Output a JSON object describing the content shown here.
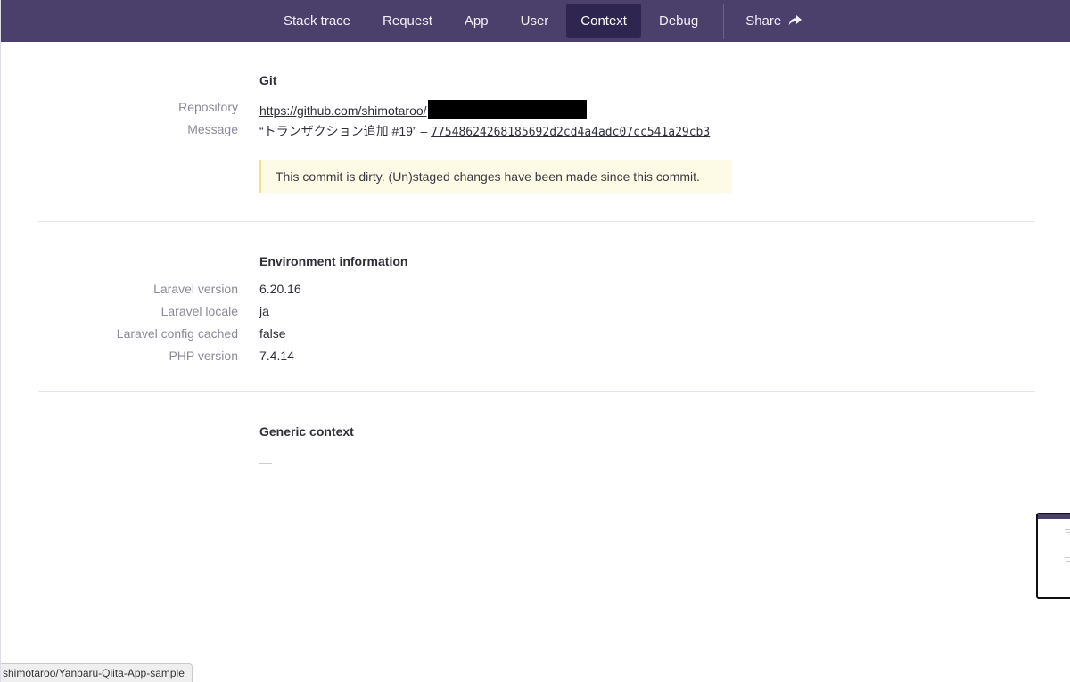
{
  "nav": {
    "tabs": [
      {
        "label": "Stack trace"
      },
      {
        "label": "Request"
      },
      {
        "label": "App"
      },
      {
        "label": "User"
      },
      {
        "label": "Context",
        "active": true
      },
      {
        "label": "Debug"
      }
    ],
    "share_label": "Share",
    "share_icon": "share-arrow-icon",
    "background_color": "#4b3f6b",
    "active_color": "#2e2550"
  },
  "git": {
    "title": "Git",
    "repository_label": "Repository",
    "repository_value": "https://github.com/shimotaroo/",
    "message_label": "Message",
    "message_text": "“トランザクション追加 #19” – ",
    "commit_hash": "77548624268185692d2cd4a4adc07cc541a29cb3",
    "notice": "This commit is dirty. (Un)staged changes have been made since this commit.",
    "notice_color": "#fdfbe5"
  },
  "environment": {
    "title": "Environment information",
    "rows": [
      {
        "label": "Laravel version",
        "value": "6.20.16"
      },
      {
        "label": "Laravel locale",
        "value": "ja"
      },
      {
        "label": "Laravel config cached",
        "value": "false"
      },
      {
        "label": "PHP version",
        "value": "7.4.14"
      }
    ]
  },
  "generic": {
    "title": "Generic context",
    "empty_value": "—"
  },
  "statusbar": {
    "text": "shimotaroo/Yanbaru-Qiita-App-sample"
  }
}
